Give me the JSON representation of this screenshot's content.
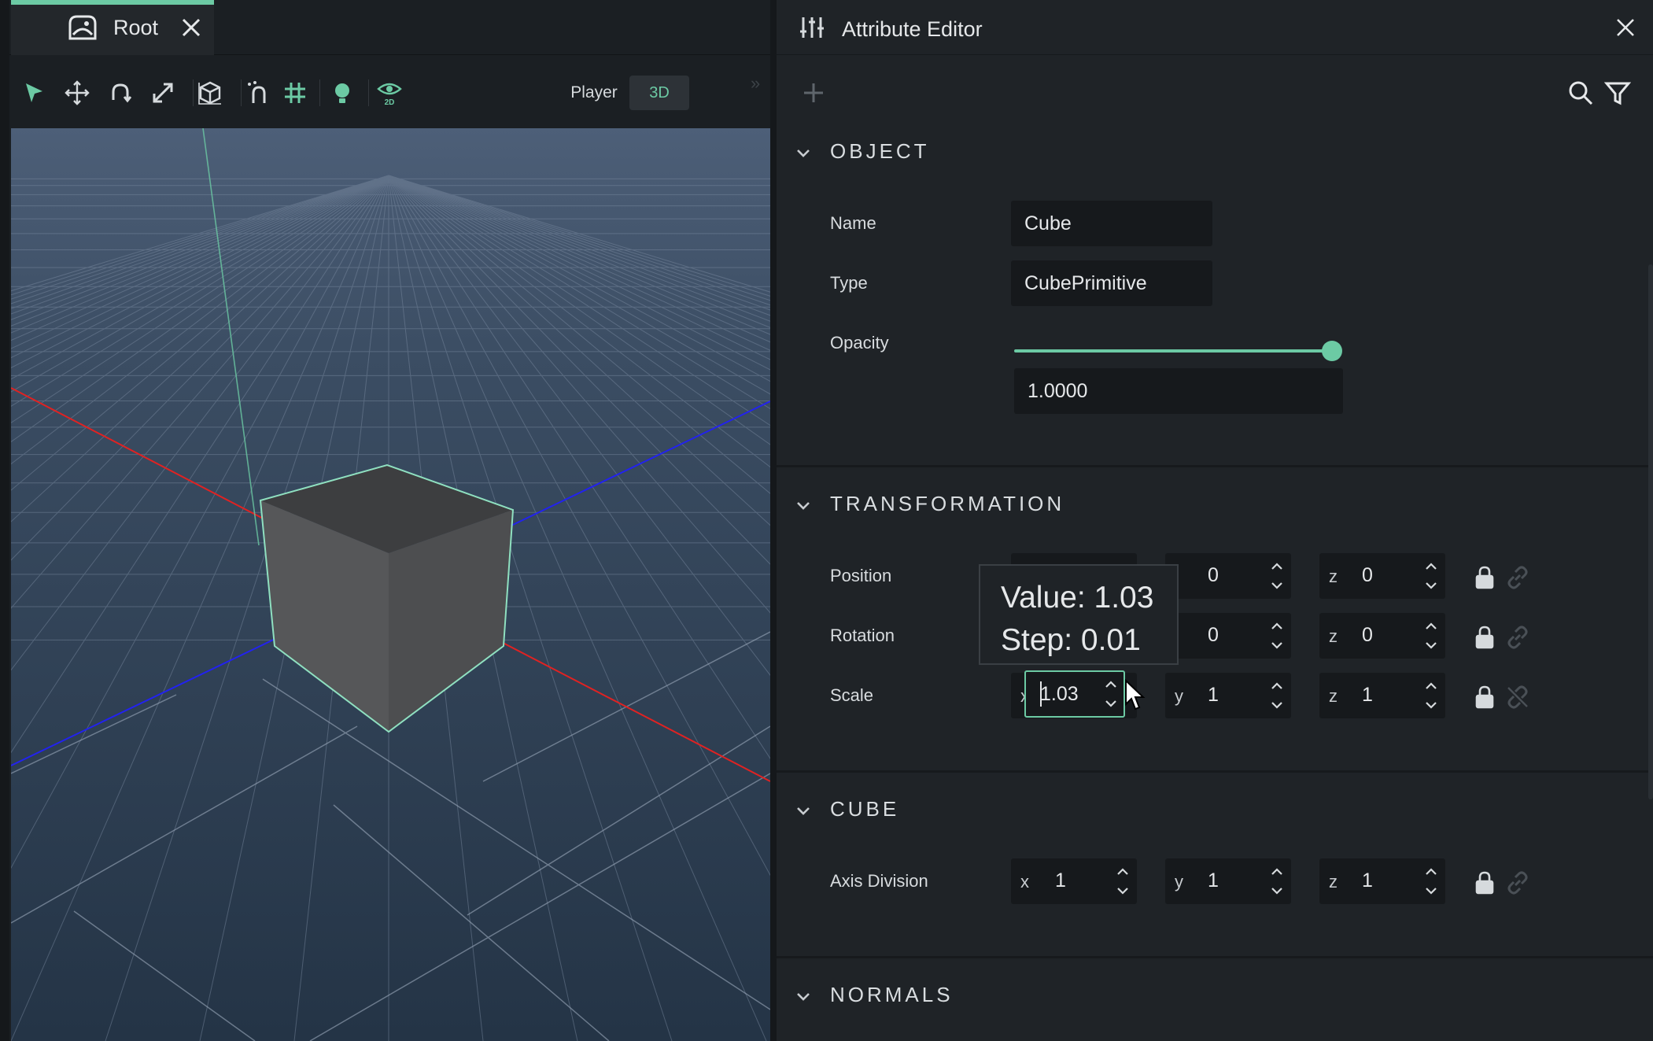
{
  "tab": {
    "label": "Root"
  },
  "toolbar": {
    "tools": [
      "select-arrow-icon",
      "move-icon",
      "rotate-icon",
      "scale-icon",
      "object-icon",
      "snap-icon",
      "grid-icon",
      "light-icon",
      "2d-view-icon"
    ],
    "player_label": "Player",
    "mode_label": "3D"
  },
  "attribute_editor": {
    "title": "Attribute Editor",
    "sections": {
      "object": {
        "title": "OBJECT",
        "name_label": "Name",
        "name_value": "Cube",
        "type_label": "Type",
        "type_value": "CubePrimitive",
        "opacity_label": "Opacity",
        "opacity_value": "1.0000",
        "opacity_fraction": 1.0
      },
      "transformation": {
        "title": "TRANSFORMATION",
        "position_label": "Position",
        "position": {
          "y": "0",
          "z": "0"
        },
        "rotation_label": "Rotation",
        "rotation": {
          "y": "0",
          "z": "0"
        },
        "scale_label": "Scale",
        "scale": {
          "x": "1.03",
          "y": "1",
          "z": "1"
        }
      },
      "cube": {
        "title": "CUBE",
        "axis_label": "Axis Division",
        "axis": {
          "x": "1",
          "y": "1",
          "z": "1"
        }
      },
      "normals": {
        "title": "NORMALS"
      }
    },
    "axis_letters": {
      "x": "x",
      "y": "y",
      "z": "z"
    }
  },
  "tooltip": {
    "value_line": "Value: 1.03",
    "step_line": "Step: 0.01"
  },
  "colors": {
    "accent": "#6ccaa4",
    "panel": "#1f2327",
    "field": "#16191c",
    "axis_red": "#e02222",
    "axis_blue": "#2222f0"
  }
}
